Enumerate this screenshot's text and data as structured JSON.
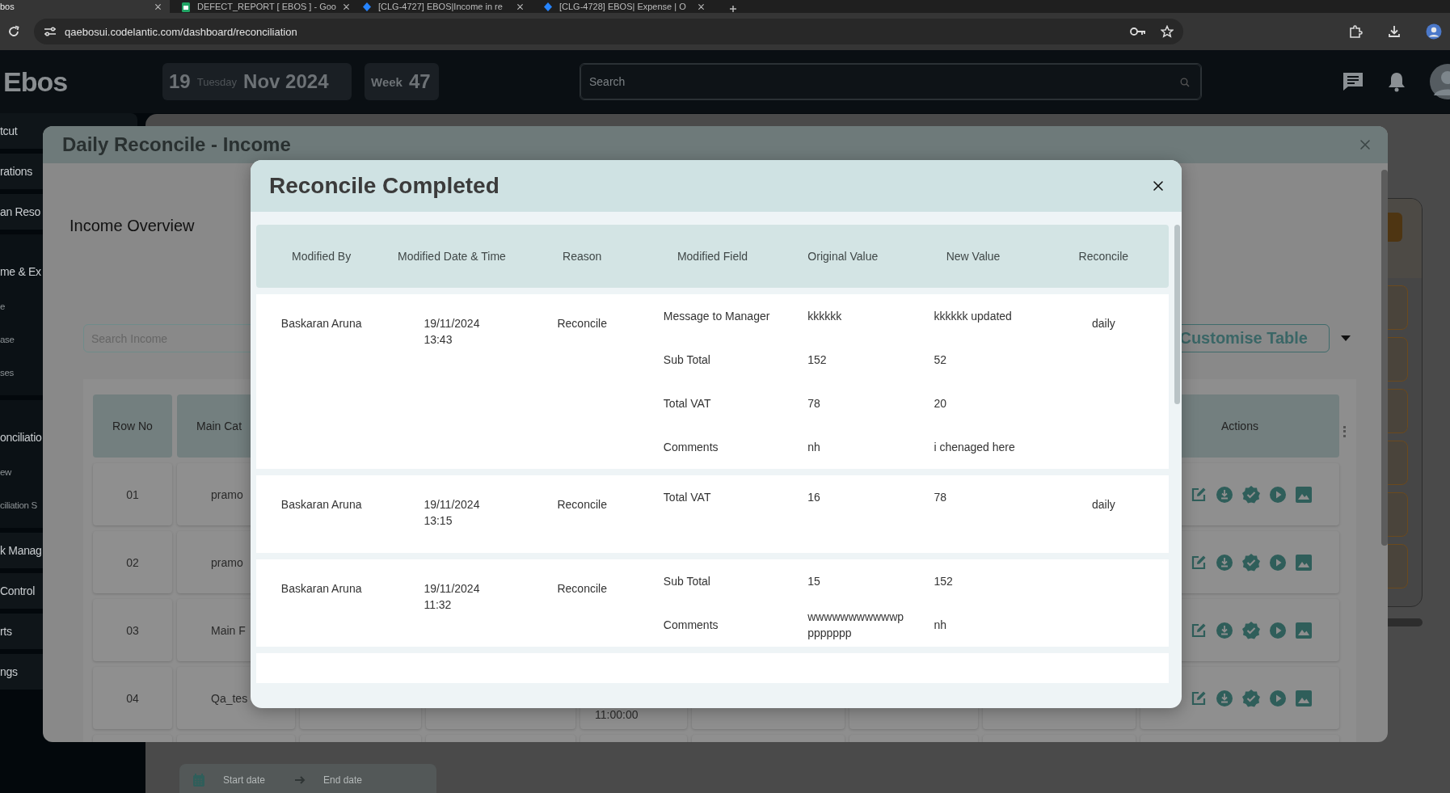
{
  "browser": {
    "tabs": [
      {
        "title": "bos",
        "selected": true,
        "kind": "app"
      },
      {
        "title": "DEFECT_REPORT [ EBOS ] - Goo",
        "selected": false,
        "kind": "sheet"
      },
      {
        "title": "[CLG-4727] EBOS|Income in re",
        "selected": false,
        "kind": "ticket"
      },
      {
        "title": "[CLG-4728] EBOS| Expense | O",
        "selected": false,
        "kind": "ticket"
      }
    ],
    "url": "qaebosui.codelantic.com/dashboard/reconciliation"
  },
  "app_header": {
    "logo": "Ebos",
    "date": {
      "day": "19",
      "weekday": "Tuesday",
      "month_year": "Nov 2024"
    },
    "week": {
      "label": "Week",
      "number": "47"
    },
    "search": {
      "placeholder": "Search"
    }
  },
  "sidebar": {
    "items": [
      {
        "label": "tcut"
      },
      {
        "label": "rations"
      },
      {
        "label": "an Reso"
      },
      {
        "label": "me & Ex",
        "children": [
          {
            "label": "e"
          },
          {
            "label": "ase"
          },
          {
            "label": "ses"
          }
        ]
      },
      {
        "label": "onciliatio",
        "children": [
          {
            "label": "ew"
          },
          {
            "label": "ciliation S"
          }
        ]
      },
      {
        "label": "k Manag"
      },
      {
        "label": "Control"
      },
      {
        "label": "rts"
      },
      {
        "label": "ngs"
      }
    ]
  },
  "date_range": {
    "start_placeholder": "Start date",
    "end_placeholder": "End date"
  },
  "daily_modal": {
    "title": "Daily Reconcile - Income",
    "section_title": "Income Overview",
    "search": {
      "placeholder": "Search Income"
    },
    "customise_button": "Customise Table",
    "table": {
      "columns": {
        "row_no": "Row No",
        "main_category": "Main Cat",
        "actions": "Actions"
      },
      "rows": [
        {
          "row_no": "01",
          "main_category": "pramo"
        },
        {
          "row_no": "02",
          "main_category": "pramo"
        },
        {
          "row_no": "03",
          "main_category": "Main F"
        },
        {
          "row_no": "04",
          "main_category": "Qa_tes",
          "time": "11:00:00"
        }
      ]
    }
  },
  "reconcile_modal": {
    "title": "Reconcile Completed",
    "columns": [
      "Modified By",
      "Modified Date & Time",
      "Reason",
      "Modified Field",
      "Original Value",
      "New Value",
      "Reconcile"
    ],
    "rows": [
      {
        "modified_by": "Baskaran Aruna",
        "date": "19/11/2024",
        "time": "13:43",
        "reason": "Reconcile",
        "reconcile": "daily",
        "changes": [
          {
            "field": "Message to Manager",
            "original": "kkkkkk",
            "new": "kkkkkk updated"
          },
          {
            "field": "Sub Total",
            "original": "152",
            "new": "52"
          },
          {
            "field": "Total VAT",
            "original": "78",
            "new": "20"
          },
          {
            "field": "Comments",
            "original": "nh",
            "new": "i chenaged here"
          }
        ]
      },
      {
        "modified_by": "Baskaran Aruna",
        "date": "19/11/2024",
        "time": "13:15",
        "reason": "Reconcile",
        "reconcile": "daily",
        "changes": [
          {
            "field": "Total VAT",
            "original": "16",
            "new": "78"
          }
        ]
      },
      {
        "modified_by": "Baskaran Aruna",
        "date": "19/11/2024",
        "time": "11:32",
        "reason": "Reconcile",
        "changes": [
          {
            "field": "Sub Total",
            "original": "15",
            "new": "152"
          },
          {
            "field": "Comments",
            "original": "wwwwwwwwwwwpppppppp",
            "new": "nh"
          }
        ]
      }
    ]
  }
}
